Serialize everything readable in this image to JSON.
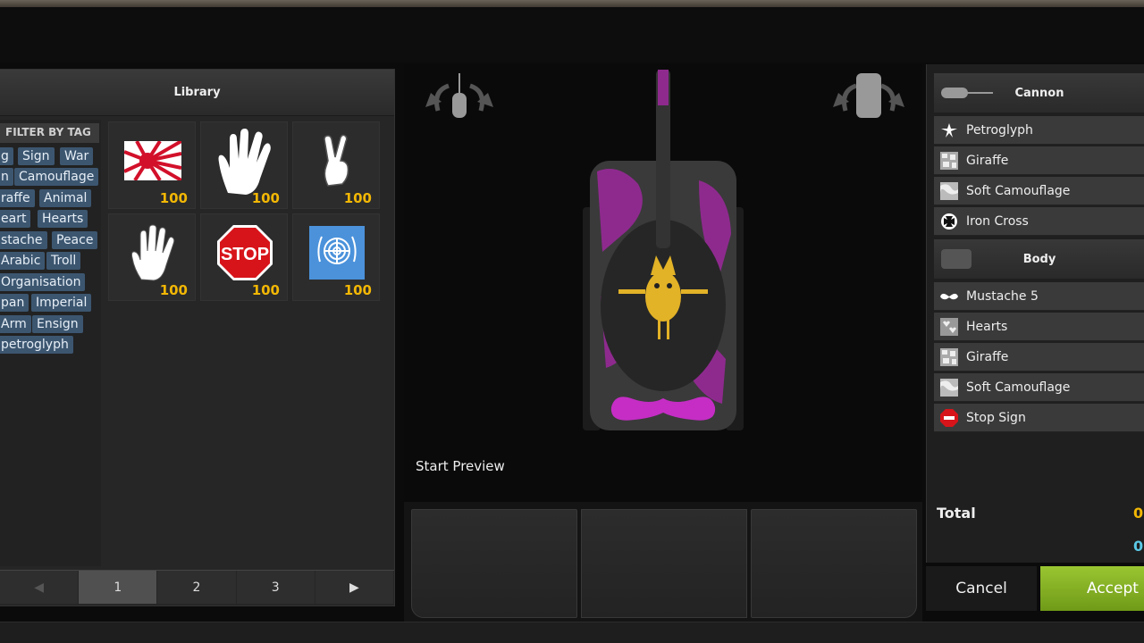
{
  "library": {
    "title": "Library",
    "filter_title": "FILTER BY TAG",
    "tags": [
      "g",
      "Sign",
      "War",
      "n",
      "Camouflage",
      "raffe",
      "Animal",
      "eart",
      "Hearts",
      "stache",
      "Peace",
      "Arabic",
      "Troll",
      "Organisation",
      "pan",
      "Imperial",
      "Arm",
      "Ensign",
      "petroglyph"
    ],
    "items": [
      {
        "icon": "rising-sun-flag-icon",
        "price": "100"
      },
      {
        "icon": "vulcan-salute-hand-icon",
        "price": "100"
      },
      {
        "icon": "peace-sign-hand-icon",
        "price": "100"
      },
      {
        "icon": "open-hand-icon",
        "price": "100"
      },
      {
        "icon": "stop-sign-icon",
        "price": "100",
        "text": "STOP"
      },
      {
        "icon": "un-emblem-icon",
        "price": "100"
      }
    ],
    "pages": [
      "◀",
      "1",
      "2",
      "3",
      "▶"
    ],
    "active_page": "1"
  },
  "preview": {
    "start_label": "Start Preview",
    "tank_color": "#8e2a8e",
    "emblem_color": "#e2b227"
  },
  "sections": {
    "cannon": {
      "title": "Cannon",
      "items": [
        {
          "label": "Petroglyph",
          "icon": "petroglyph-icon"
        },
        {
          "label": "Giraffe",
          "icon": "giraffe-pattern-icon"
        },
        {
          "label": "Soft Camouflage",
          "icon": "camouflage-pattern-icon"
        },
        {
          "label": "Iron Cross",
          "icon": "iron-cross-icon"
        }
      ]
    },
    "body": {
      "title": "Body",
      "items": [
        {
          "label": "Mustache 5",
          "icon": "mustache-icon"
        },
        {
          "label": "Hearts",
          "icon": "hearts-pattern-icon"
        },
        {
          "label": "Giraffe",
          "icon": "giraffe-pattern-icon"
        },
        {
          "label": "Soft Camouflage",
          "icon": "camouflage-pattern-icon"
        },
        {
          "label": "Stop Sign",
          "icon": "stop-sign-icon"
        }
      ]
    }
  },
  "total": {
    "label": "Total",
    "gold": "0",
    "blue": "0"
  },
  "buttons": {
    "cancel": "Cancel",
    "accept": "Accept"
  },
  "colors": {
    "gold": "#f2b705",
    "accent_green": "#8ab62a",
    "tag_blue": "#3c5670",
    "credit_blue": "#5bc9e6"
  }
}
